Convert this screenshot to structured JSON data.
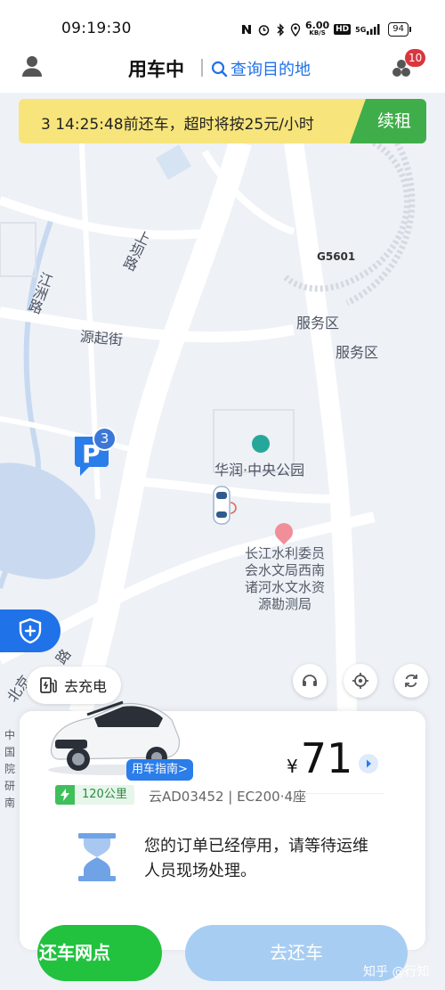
{
  "status_bar": {
    "time": "09:19:30",
    "net_speed_value": "6.00",
    "net_speed_unit": "KB/S",
    "hd_label": "HD",
    "network_label": "5G",
    "battery": "94"
  },
  "header": {
    "title": "用车中",
    "search_label": "查询目的地",
    "message_count": "10"
  },
  "notice": {
    "text": "3 14:25:48前还车，超时将按25元/小时",
    "renew_label": "续租"
  },
  "map": {
    "labels": {
      "road_jiangzhou": "江洲路",
      "road_shangba": "上坝路",
      "road_yuanqi": "源起街",
      "road_beijing": "北京",
      "road_xxx_lu": "路",
      "highway": "G5601",
      "service_area_1": "服务区",
      "service_area_2": "服务区",
      "poi_park": "华润·中央公园",
      "poi_commission": "长江水利委员\n会水文局西南\n诸河水文水资\n源勘测局",
      "left_edge": "中国\n院研\n南"
    },
    "parking_count": "3",
    "charge_label": "去充电"
  },
  "card": {
    "guide_label": "用车指南>",
    "price_symbol": "¥",
    "price_value": "71",
    "range": "120公里",
    "plate_info": "云AD03452 | EC200·4座",
    "message": "您的订单已经停用，请等待运维人员现场处理。"
  },
  "actions": {
    "return_points": "还车网点",
    "go_return": "去还车"
  },
  "watermark": "知乎 @行知",
  "colors": {
    "accent_blue": "#1f72e8",
    "accent_green": "#22c23f",
    "notice_yellow": "#f7e57c",
    "badge_red": "#d9363e"
  }
}
